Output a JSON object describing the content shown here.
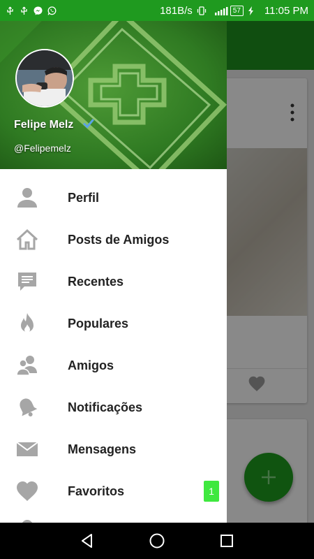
{
  "status_bar": {
    "left_icons": [
      "usb-icon",
      "usb-icon",
      "messenger-icon",
      "whatsapp-icon"
    ],
    "net_speed": "181B/s",
    "battery": "57",
    "time": "11:05 PM",
    "bg_color": "#1f9a1f"
  },
  "drawer": {
    "user": {
      "name": "Felipe Melz",
      "handle": "@Felipemelz",
      "verified": true
    },
    "menu": [
      {
        "label": "Perfil",
        "icon": "person-icon"
      },
      {
        "label": "Posts de Amigos",
        "icon": "home-icon"
      },
      {
        "label": "Recentes",
        "icon": "chat-bubble-icon"
      },
      {
        "label": "Populares",
        "icon": "flame-icon"
      },
      {
        "label": "Amigos",
        "icon": "people-icon"
      },
      {
        "label": "Notificações",
        "icon": "bell-icon"
      },
      {
        "label": "Mensagens",
        "icon": "envelope-icon"
      },
      {
        "label": "Favoritos",
        "icon": "heart-icon",
        "badge": "1"
      }
    ]
  },
  "colors": {
    "accent": "#1e9a1e",
    "badge": "#3fe83f",
    "icon_gray": "#a6a6a6"
  },
  "background_app": {
    "fab_icon": "plus-icon"
  }
}
